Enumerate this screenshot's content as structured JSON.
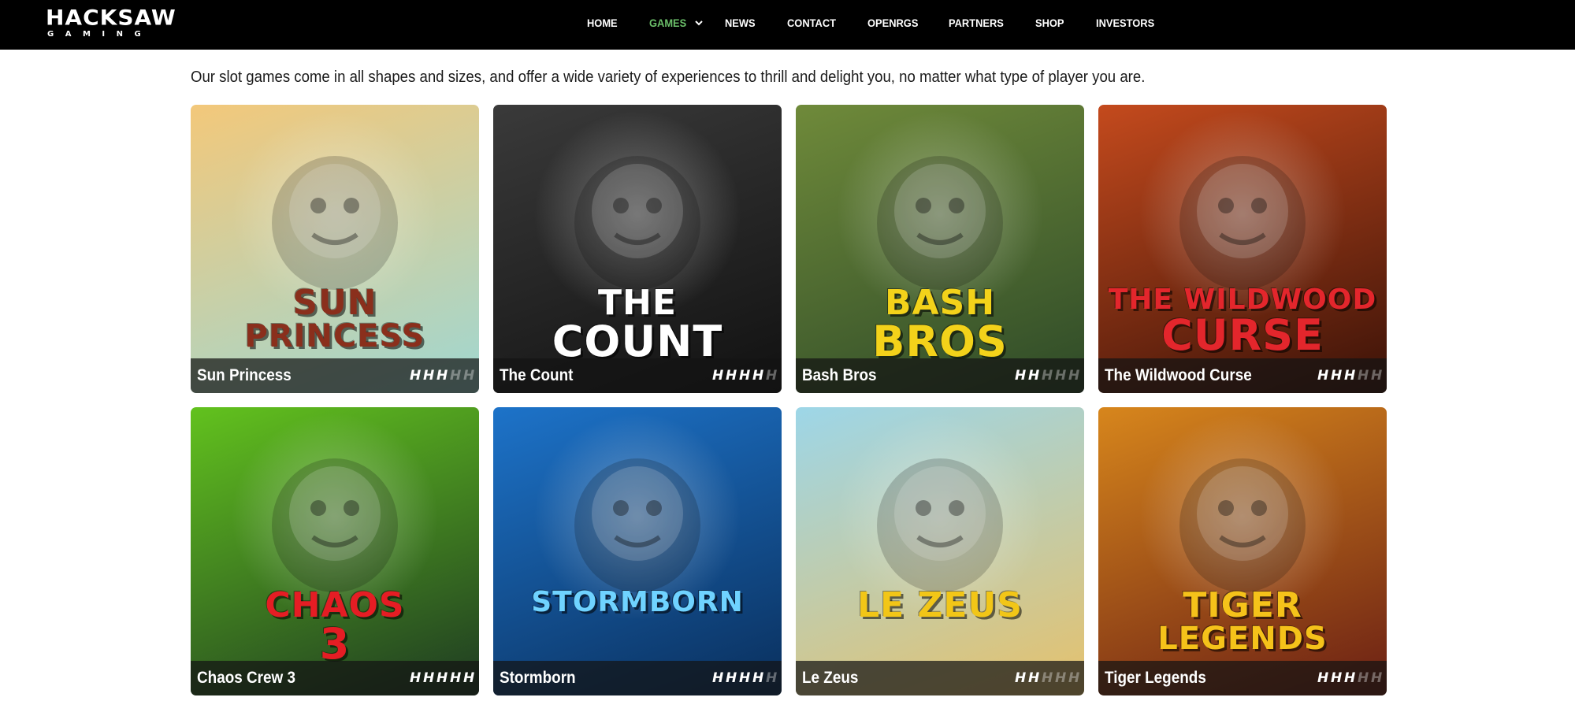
{
  "header": {
    "logo_main": "HACKSAW",
    "logo_sub": "GAMING",
    "nav": [
      {
        "label": "HOME",
        "active": false
      },
      {
        "label": "GAMES",
        "active": true,
        "has_dropdown": true
      },
      {
        "label": "NEWS",
        "active": false
      },
      {
        "label": "CONTACT",
        "active": false
      },
      {
        "label": "OPENRGS",
        "active": false
      },
      {
        "label": "PARTNERS",
        "active": false
      },
      {
        "label": "SHOP",
        "active": false
      },
      {
        "label": "INVESTORS",
        "active": false
      }
    ],
    "active_color": "#6cc06a"
  },
  "intro": {
    "text": "Our slot games come in all shapes and sizes, and offer a wide variety of experiences to thrill and delight you, no matter what type of player you are."
  },
  "games": [
    {
      "title": "Sun Princess",
      "logo_line1": "SUN",
      "logo_line2": "PRINCESS",
      "volatility": 3,
      "volatility_max": 5,
      "bg": [
        "#f3c87a",
        "#9fd7d2"
      ],
      "logo_color": "#8a2f1c"
    },
    {
      "title": "The Count",
      "logo_line1": "THE",
      "logo_line2": "COUNT",
      "volatility": 4,
      "volatility_max": 5,
      "bg": [
        "#3a3a3a",
        "#111111"
      ],
      "logo_color": "#ffffff"
    },
    {
      "title": "Bash Bros",
      "logo_line1": "BASH",
      "logo_line2": "BROS",
      "volatility": 2,
      "volatility_max": 5,
      "bg": [
        "#6f8a3a",
        "#2e4a28"
      ],
      "logo_color": "#f3d21a"
    },
    {
      "title": "The Wildwood Curse",
      "logo_line1": "THE WILDWOOD",
      "logo_line2": "CURSE",
      "volatility": 3,
      "volatility_max": 5,
      "bg": [
        "#c44a1d",
        "#3a1208"
      ],
      "logo_color": "#e3262c"
    },
    {
      "title": "Chaos Crew 3",
      "logo_line1": "CHAOS",
      "logo_line2": "3",
      "volatility": 5,
      "volatility_max": 5,
      "bg": [
        "#62c21e",
        "#1e3a22"
      ],
      "logo_color": "#e51d24"
    },
    {
      "title": "Stormborn",
      "logo_line1": "STORMBORN",
      "logo_line2": "",
      "volatility": 4,
      "volatility_max": 5,
      "bg": [
        "#1d73c9",
        "#0a2f5c"
      ],
      "logo_color": "#6fd3ff"
    },
    {
      "title": "Le Zeus",
      "logo_line1": "LE ZEUS",
      "logo_line2": "",
      "volatility": 2,
      "volatility_max": 5,
      "bg": [
        "#9dd6e8",
        "#e6c16b"
      ],
      "logo_color": "#f2c617"
    },
    {
      "title": "Tiger Legends",
      "logo_line1": "TIGER",
      "logo_line2": "LEGENDS",
      "volatility": 3,
      "volatility_max": 5,
      "bg": [
        "#d7861c",
        "#6a1f14"
      ],
      "logo_color": "#f5c21a"
    }
  ]
}
